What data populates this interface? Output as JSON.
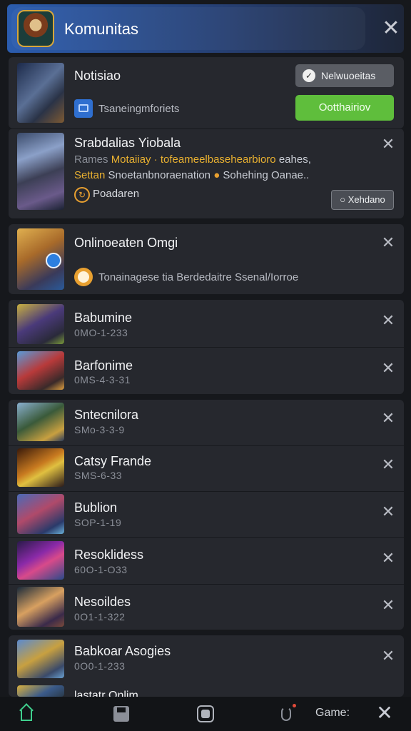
{
  "header": {
    "title": "Komunitas"
  },
  "notif_card": {
    "title": "Notisiao",
    "info": "Tsaneingmforiets",
    "btn_gray": "Nelwuoeitas",
    "btn_green": "Ootthairiov"
  },
  "feature_card": {
    "title": "Srabdalias Yiobala",
    "line1_prefix": "Rames",
    "line1_highlight": "Motaiiay · tofeameelbasehearbioro",
    "line1_suffix": "eahes,",
    "line2_prefix": "Settan",
    "line2_text": "Snoetanbnoraenation",
    "line2_suffix": "Sohehing Oanae..",
    "link": "Poadaren",
    "action": "Xehdano"
  },
  "online_card": {
    "title": "Onlinoeaten Omgi",
    "desc": "Tonainagese tia Berdedaitre Ssenal/Iorroe"
  },
  "games": [
    {
      "name": "Babumine",
      "code": "0MO-1-233"
    },
    {
      "name": "Barfonime",
      "code": "0MS-4-3-31"
    },
    {
      "name": "Sntecnilora",
      "code": "SMo-3-3-9"
    },
    {
      "name": "Catsy Frande",
      "code": "SMS-6-33"
    },
    {
      "name": "Bublion",
      "code": "SOP-1-19"
    },
    {
      "name": "Resoklidess",
      "code": "60O-1-O33"
    },
    {
      "name": "Nesoildes",
      "code": "0O1-1-322"
    },
    {
      "name": "Babkoar Asogies",
      "code": "0O0-1-233"
    },
    {
      "name": "lastatr Onlim",
      "code": ""
    }
  ],
  "bottom_nav": {
    "label": "Game:"
  },
  "icons": {
    "close": "close-icon",
    "home": "home-icon",
    "save": "save-icon",
    "game": "gamepad-icon",
    "mic": "microphone-icon"
  },
  "colors": {
    "accent_green": "#5fbe3c",
    "header_blue": "#2b5cae",
    "warning": "#e8a030"
  }
}
